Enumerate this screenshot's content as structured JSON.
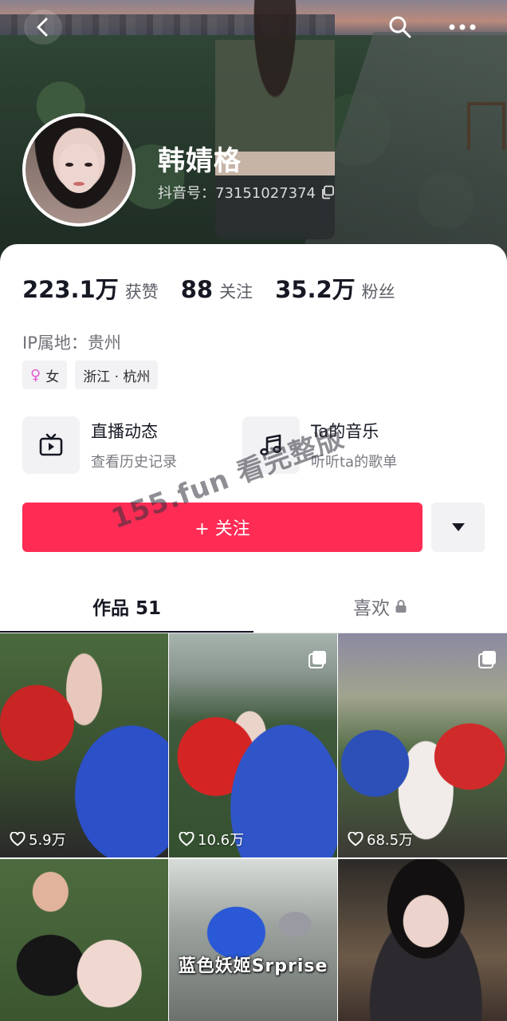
{
  "profile": {
    "nickname": "韩婧格",
    "douyin_id": "抖音号：73151027374",
    "ip_location": "IP属地：贵州"
  },
  "stats": [
    {
      "num": "223.1万",
      "label": "获赞"
    },
    {
      "num": "88",
      "label": "关注"
    },
    {
      "num": "35.2万",
      "label": "粉丝"
    }
  ],
  "tags": {
    "gender": "女",
    "region": "浙江 · 杭州"
  },
  "features": {
    "live": {
      "title": "直播动态",
      "subtitle": "查看历史记录"
    },
    "music": {
      "title": "Ta的音乐",
      "subtitle": "听听ta的歌单"
    }
  },
  "follow_button": "+ 关注",
  "watermark": "155.fun 看完整版",
  "tabs": {
    "works": "作品 51",
    "likes": "喜欢"
  },
  "videos": [
    {
      "likes": "5.9万",
      "multi": false
    },
    {
      "likes": "10.6万",
      "multi": true
    },
    {
      "likes": "68.5万",
      "multi": true
    },
    {
      "likes": "",
      "multi": false
    },
    {
      "likes": "",
      "caption": "蓝色妖姬Srprise",
      "multi": false
    },
    {
      "likes": "",
      "multi": false
    }
  ],
  "icons": {
    "back": "back-icon",
    "search": "search-icon",
    "more": "more-icon",
    "copy": "copy-icon",
    "female": "female-icon",
    "tv": "tv-icon",
    "music": "music-note-icon",
    "dropdown": "caret-down-icon",
    "lock": "lock-icon",
    "heart": "heart-icon"
  },
  "colors": {
    "accent": "#fe2c55",
    "female": "#e35ad0"
  }
}
